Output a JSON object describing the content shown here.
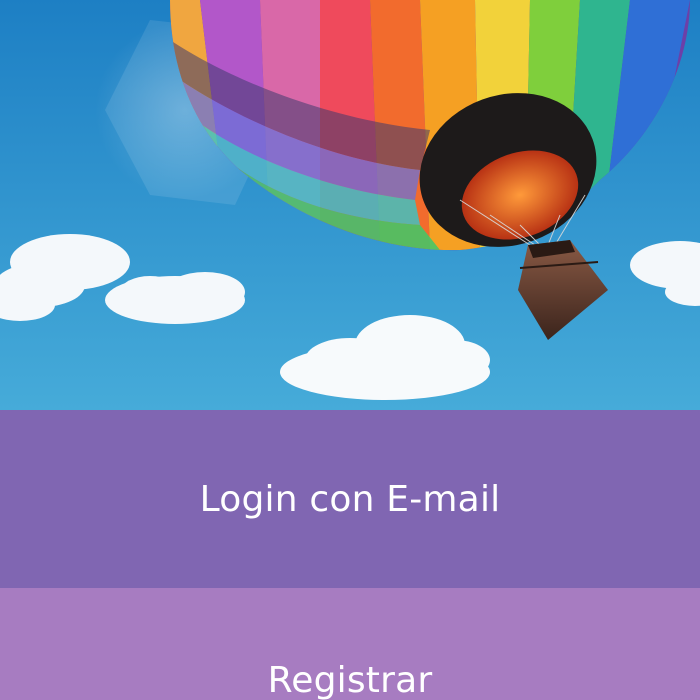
{
  "hero": {
    "image": "hot-air-balloon-sky-image"
  },
  "actions": {
    "login_label": "Login con E-mail",
    "register_label": "Registrar"
  },
  "colors": {
    "sky_top": "#1f86c9",
    "sky_bottom": "#43a8d8",
    "login_bg": "#8066b2",
    "register_bg": "#a77cc1"
  }
}
